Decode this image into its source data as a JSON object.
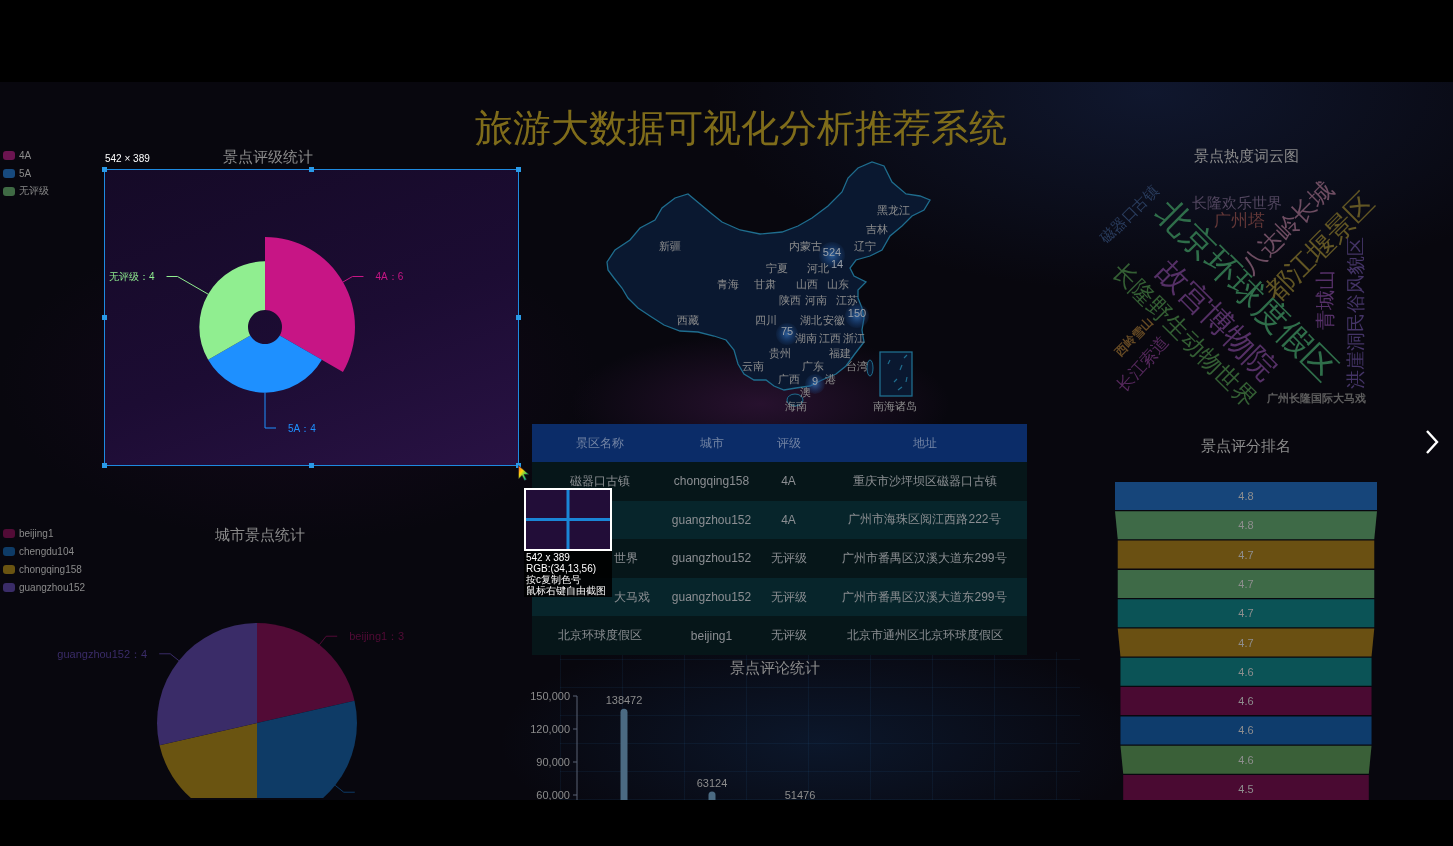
{
  "title": "旅游大数据可视化分析推荐系统",
  "rating_panel": {
    "title": "景点评级统计",
    "legend": [
      {
        "label": "4A",
        "color": "#6b1450"
      },
      {
        "label": "5A",
        "color": "#174a7e"
      },
      {
        "label": "无评级",
        "color": "#3f6a44"
      }
    ],
    "slices": [
      {
        "label": "4A：6",
        "color": "#c71585"
      },
      {
        "label": "5A：4",
        "color": "#1e90ff"
      },
      {
        "label": "无评级：4",
        "color": "#90ee90"
      }
    ]
  },
  "city_panel": {
    "chart_data": {
      "type": "pie",
      "title": "城市景点统计",
      "categories": [
        "beijing1",
        "chengdu104",
        "chongqing158",
        "guangzhou152"
      ],
      "values": [
        3,
        4,
        3,
        4
      ],
      "colors": [
        "#520b36",
        "#0e3b66",
        "#6a5411",
        "#3a2c68"
      ],
      "value_labels": [
        "beijing1：3",
        null,
        null,
        "guangzhou152：4"
      ]
    }
  },
  "map": {
    "regions": [
      "黑龙江",
      "吉林",
      "新疆",
      "内蒙古",
      "辽宁",
      "宁夏",
      "河北",
      "青海",
      "甘肃",
      "山西",
      "山东",
      "陕西",
      "河南",
      "江苏",
      "西藏",
      "四川",
      "湖北",
      "安徽",
      "湖南",
      "江西",
      "浙江",
      "贵州",
      "福建",
      "云南",
      "广东",
      "台湾",
      "广西",
      "港",
      "澳",
      "海南",
      "南海诸岛"
    ],
    "markers": [
      "524",
      "14",
      "150",
      "75",
      "9"
    ]
  },
  "table": {
    "columns": [
      "景区名称",
      "城市",
      "评级",
      "地址"
    ],
    "rows": [
      {
        "cells": [
          "磁器口古镇",
          "chongqing158",
          "4A",
          "重庆市沙坪坝区磁器口古镇"
        ],
        "covered": false
      },
      {
        "cells": [
          null,
          "guangzhou152",
          "4A",
          "广州市海珠区阅江西路222号"
        ]
      },
      {
        "cells": [
          "世界",
          "guangzhou152",
          "无评级",
          "广州市番禺区汉溪大道东299号"
        ],
        "covered": true
      },
      {
        "cells": [
          "大马戏",
          "guangzhou152",
          "无评级",
          "广州市番禺区汉溪大道东299号"
        ],
        "covered": true
      },
      {
        "cells": [
          "北京环球度假区",
          "beijing1",
          "无评级",
          "北京市通州区北京环球度假区"
        ],
        "covered": false
      }
    ]
  },
  "comment_chart": {
    "title": "景点评论统计",
    "axis_labels": [
      "150,000",
      "120,000",
      "90,000",
      "60,000"
    ],
    "value_labels": [
      "138472",
      "63124",
      "51476"
    ]
  },
  "word_cloud": {
    "title": "景点热度词云图",
    "words": [
      {
        "text": "长隆欢乐世界",
        "color": "#52465f"
      },
      {
        "text": "广州塔",
        "color": "#643838"
      },
      {
        "text": "北京环球度假区",
        "color": "#2f6e4a"
      },
      {
        "text": "故宫博物院",
        "color": "#553066"
      },
      {
        "text": "八达岭长城",
        "color": "#6e4d62"
      },
      {
        "text": "都江堰景区",
        "color": "#625624"
      },
      {
        "text": "磁器口古镇",
        "color": "#2a3d5e"
      },
      {
        "text": "长隆野生动物世界",
        "color": "#345f34"
      },
      {
        "text": "青城山",
        "color": "#553068"
      },
      {
        "text": "洪崖洞民俗风貌区",
        "color": "#443466"
      },
      {
        "text": "西岭雪山",
        "color": "#664a24"
      },
      {
        "text": "长江索道",
        "color": "#55285c"
      },
      {
        "text": "广州长隆国际大马戏",
        "color": "#5e5e5e"
      }
    ]
  },
  "ranking": {
    "title": "景点评分排名",
    "bars": [
      {
        "score": "4.8",
        "color": "#16457a"
      },
      {
        "score": "4.8",
        "color": "#3e6a47"
      },
      {
        "score": "4.7",
        "color": "#6a5012"
      },
      {
        "score": "4.7",
        "color": "#3e6a47"
      },
      {
        "score": "4.7",
        "color": "#0b5356"
      },
      {
        "score": "4.7",
        "color": "#6a5012"
      },
      {
        "score": "4.6",
        "color": "#0b5356"
      },
      {
        "score": "4.6",
        "color": "#4a0a32"
      },
      {
        "score": "4.6",
        "color": "#0e3c6c"
      },
      {
        "score": "4.6",
        "color": "#3a6038"
      },
      {
        "score": "4.5",
        "color": "#4a0a32"
      }
    ]
  },
  "screenshot_tool": {
    "size_label": "542 × 389",
    "info_lines": [
      "542 x 389",
      "RGB:(34,13,56)",
      "按c复制色号",
      "鼠标右键自由截图"
    ]
  }
}
